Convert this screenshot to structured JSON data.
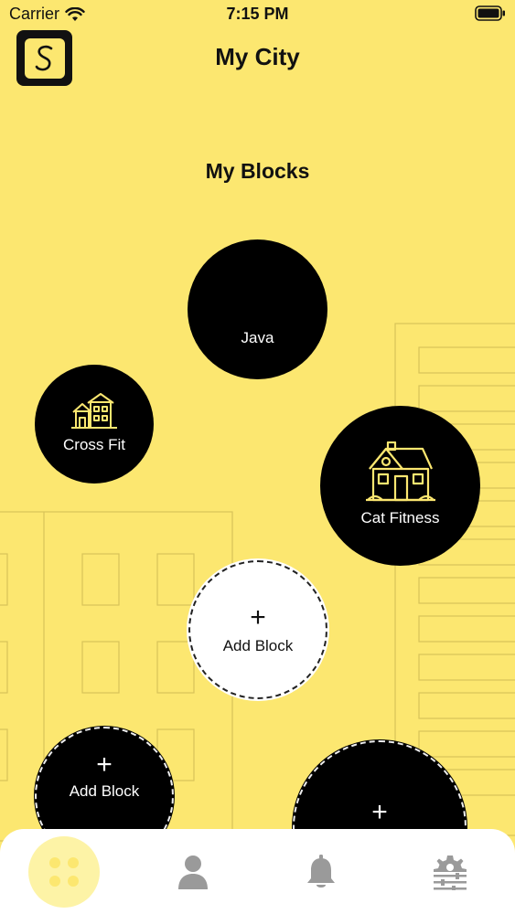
{
  "status_bar": {
    "carrier": "Carrier",
    "time": "7:15 PM"
  },
  "header": {
    "title": "My City",
    "logo_letter": "S"
  },
  "section": {
    "title": "My Blocks"
  },
  "blocks": [
    {
      "label": "Java",
      "icon": "none"
    },
    {
      "label": "Cross Fit",
      "icon": "houses-icon"
    },
    {
      "label": "Cat Fitness",
      "icon": "house-icon"
    },
    {
      "label": "Add Block",
      "icon": "plus-icon"
    },
    {
      "label": "Add Block",
      "icon": "plus-icon"
    },
    {
      "label": "",
      "icon": "plus-icon"
    }
  ],
  "tab_bar": {
    "tabs": [
      {
        "name": "home",
        "icon": "grid-dots-icon",
        "active": true
      },
      {
        "name": "profile",
        "icon": "person-icon",
        "active": false
      },
      {
        "name": "notifications",
        "icon": "bell-icon",
        "active": false
      },
      {
        "name": "settings",
        "icon": "settings-sliders-icon",
        "active": false
      }
    ]
  },
  "colors": {
    "background": "#fce770",
    "block": "#000000",
    "accent_icon": "#fce770",
    "tab_bar": "#ffffff",
    "inactive_icon": "#9a9a9a"
  }
}
